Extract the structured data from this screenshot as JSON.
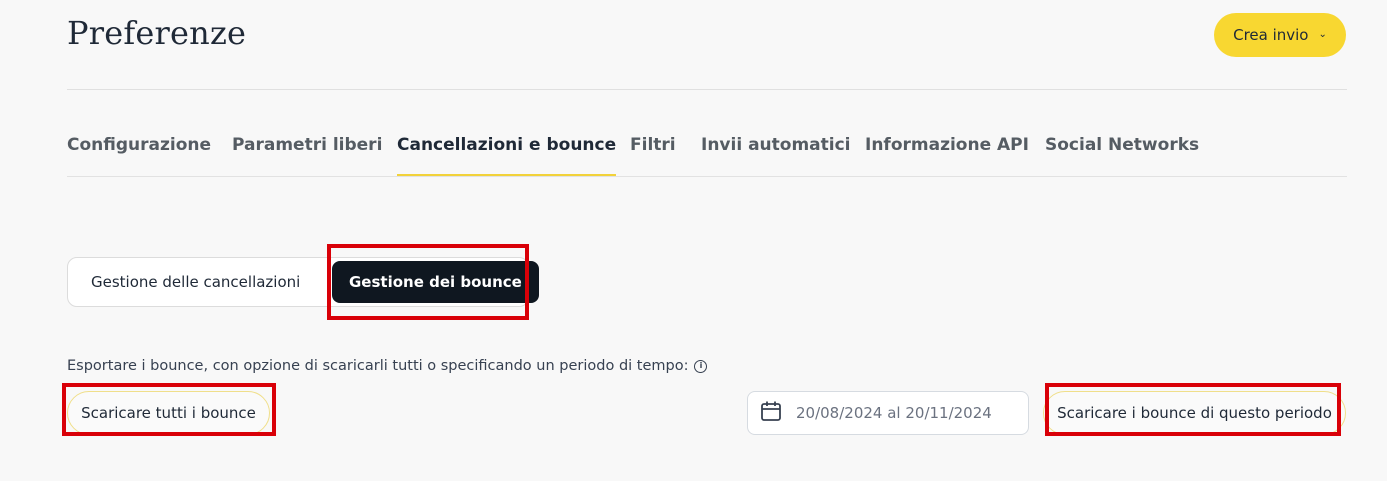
{
  "header": {
    "title": "Preferenze",
    "create_button": {
      "label": "Crea invio",
      "icon": "chevron-down-icon"
    }
  },
  "tabs": [
    {
      "label": "Configurazione",
      "active": false
    },
    {
      "label": "Parametri liberi",
      "active": false
    },
    {
      "label": "Cancellazioni e bounce",
      "active": true
    },
    {
      "label": "Filtri",
      "active": false
    },
    {
      "label": "Invii automatici",
      "active": false
    },
    {
      "label": "Informazione API",
      "active": false
    },
    {
      "label": "Social Networks",
      "active": false
    }
  ],
  "toggle": {
    "options": [
      "Gestione delle cancellazioni",
      "Gestione dei bounce"
    ],
    "selected": "Gestione dei bounce"
  },
  "export": {
    "description": "Esportare i bounce, con opzione di scaricarli tutti o specificando un periodo di tempo:",
    "info_icon": "info-icon",
    "download_all_label": "Scaricare tutti i bounce",
    "date_range": {
      "icon": "calendar-icon",
      "value": "20/08/2024 al 20/11/2024"
    },
    "download_period_label": "Scaricare i bounce di questo periodo"
  },
  "colors": {
    "accent_yellow": "#f8d731",
    "selected_dark": "#0f1720",
    "highlight_red": "#d90008",
    "background": "#f8f8f8"
  }
}
